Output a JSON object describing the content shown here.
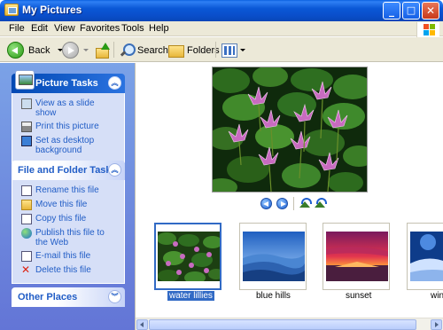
{
  "window": {
    "title": "My Pictures",
    "buttons": {
      "minimize": "_",
      "maximize": "□",
      "close": "✕"
    }
  },
  "menu": [
    "File",
    "Edit",
    "View",
    "Favorites",
    "Tools",
    "Help"
  ],
  "toolbar": {
    "back_label": "Back",
    "search_label": "Search",
    "folders_label": "Folders"
  },
  "task_pane": {
    "picture_tasks": {
      "title": "Picture Tasks",
      "items": [
        "View as a slide show",
        "Print this picture",
        "Set as desktop background"
      ]
    },
    "file_folder_tasks": {
      "title": "File and Folder Tasks",
      "items": [
        "Rename this file",
        "Move this file",
        "Copy this file",
        "Publish this file to the Web",
        "E-mail this file",
        "Delete this file"
      ]
    },
    "other_places": {
      "title": "Other Places"
    },
    "chevron_up": "︽",
    "chevron_down": "︾"
  },
  "filmstrip": {
    "items": [
      {
        "label": "water lillies",
        "selected": true
      },
      {
        "label": "blue hills",
        "selected": false
      },
      {
        "label": "sunset",
        "selected": false
      },
      {
        "label": "win",
        "selected": false
      }
    ]
  },
  "colors": {
    "title_bar": "#0a57d6",
    "task_pane_bg": "#7ba2e7",
    "link": "#215dc6",
    "selection": "#316ac5"
  }
}
